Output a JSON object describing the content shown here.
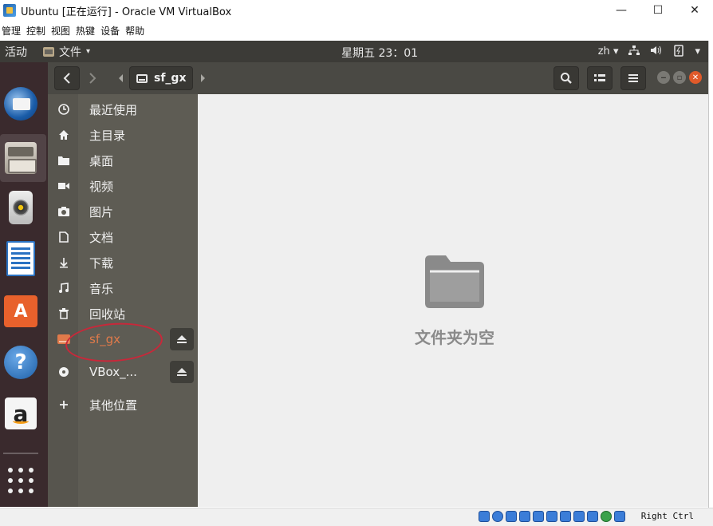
{
  "host_window": {
    "title": "Ubuntu [正在运行] - Oracle VM VirtualBox",
    "controls": {
      "minimize": "—",
      "maximize": "☐",
      "close": "✕"
    },
    "menu": [
      "管理",
      "控制",
      "视图",
      "热键",
      "设备",
      "帮助"
    ]
  },
  "topbar": {
    "activities": "活动",
    "app_menu": "文件",
    "app_menu_caret": "▾",
    "clock": "星期五 23：01",
    "input_method": "zh",
    "input_caret": "▾",
    "power_caret": "▾"
  },
  "dock": {
    "apps": [
      "thunderbird-icon",
      "files-icon",
      "rhythmbox-icon",
      "libreoffice-writer-icon",
      "ubuntu-software-icon",
      "help-icon",
      "amazon-icon",
      "show-applications-icon"
    ]
  },
  "files": {
    "path_label": "sf_gx",
    "sidebar": {
      "items": [
        {
          "label": "最近使用",
          "icon": "clock-icon"
        },
        {
          "label": "主目录",
          "icon": "home-icon"
        },
        {
          "label": "桌面",
          "icon": "folder-icon"
        },
        {
          "label": "视频",
          "icon": "video-icon"
        },
        {
          "label": "图片",
          "icon": "camera-icon"
        },
        {
          "label": "文档",
          "icon": "document-icon"
        },
        {
          "label": "下载",
          "icon": "download-icon"
        },
        {
          "label": "音乐",
          "icon": "music-icon"
        },
        {
          "label": "回收站",
          "icon": "trash-icon"
        },
        {
          "label": "sf_gx",
          "icon": "drive-icon"
        },
        {
          "label": "VBox_...",
          "icon": "disc-icon"
        },
        {
          "label": "其他位置",
          "icon": "plus-icon"
        }
      ]
    },
    "empty_message": "文件夹为空"
  },
  "statusbar": {
    "host_key": "Right Ctrl"
  }
}
